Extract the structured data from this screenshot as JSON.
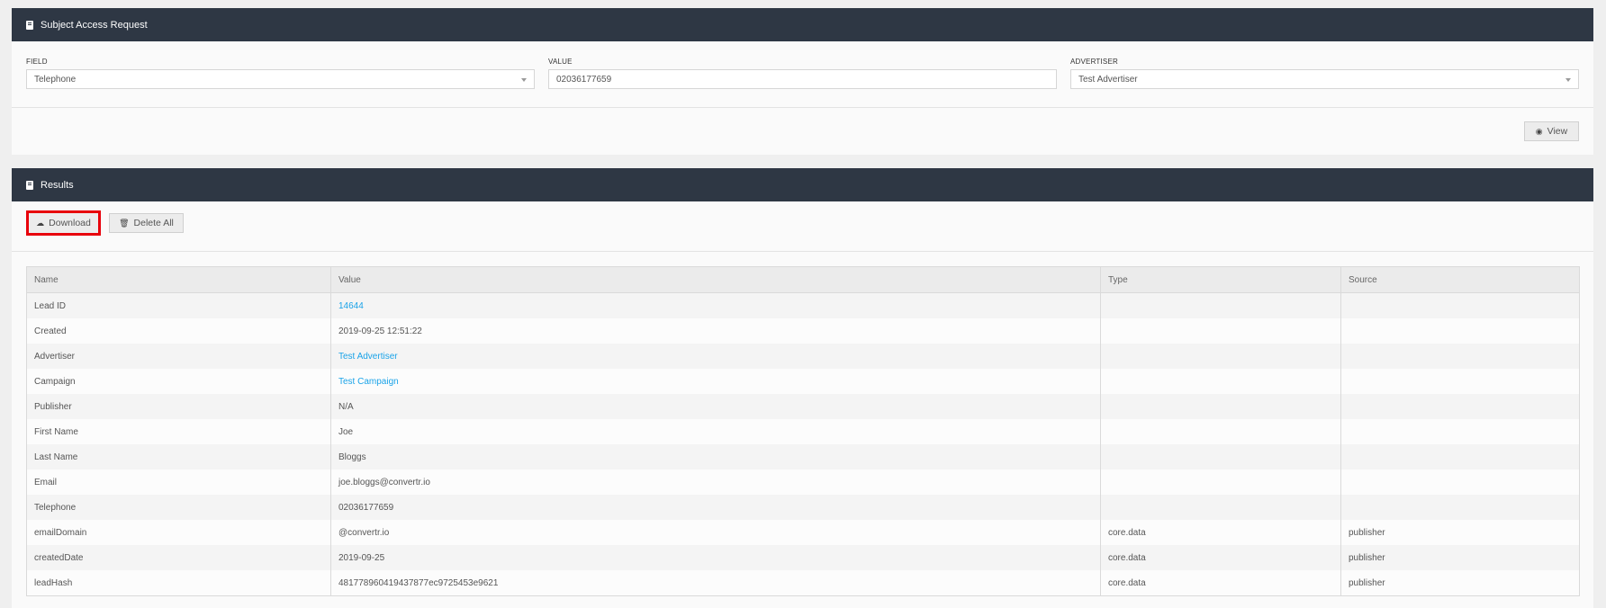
{
  "sar_panel": {
    "title": "Subject Access Request",
    "field": {
      "label": "FIELD",
      "value": "Telephone"
    },
    "value": {
      "label": "VALUE",
      "value": "02036177659"
    },
    "advertiser": {
      "label": "ADVERTISER",
      "value": "Test Advertiser"
    },
    "view_button": "View"
  },
  "results_panel": {
    "title": "Results",
    "download_button": "Download",
    "delete_all_button": "Delete All",
    "columns": [
      "Name",
      "Value",
      "Type",
      "Source"
    ],
    "rows": [
      {
        "name": "Lead ID",
        "value": "14644",
        "type": "",
        "source": ""
      },
      {
        "name": "Created",
        "value": "2019-09-25 12:51:22",
        "type": "",
        "source": ""
      },
      {
        "name": "Advertiser",
        "value": "Test Advertiser",
        "type": "",
        "source": ""
      },
      {
        "name": "Campaign",
        "value": "Test Campaign",
        "type": "",
        "source": ""
      },
      {
        "name": "Publisher",
        "value": "N/A",
        "type": "",
        "source": ""
      },
      {
        "name": "First Name",
        "value": "Joe",
        "type": "",
        "source": ""
      },
      {
        "name": "Last Name",
        "value": "Bloggs",
        "type": "",
        "source": ""
      },
      {
        "name": "Email",
        "value": "joe.bloggs@convertr.io",
        "type": "",
        "source": ""
      },
      {
        "name": "Telephone",
        "value": "02036177659",
        "type": "",
        "source": ""
      },
      {
        "name": "emailDomain",
        "value": "@convertr.io",
        "type": "core.data",
        "source": "publisher"
      },
      {
        "name": "createdDate",
        "value": "2019-09-25",
        "type": "core.data",
        "source": "publisher"
      },
      {
        "name": "leadHash",
        "value": "481778960419437877ec9725453e9621",
        "type": "core.data",
        "source": "publisher"
      }
    ]
  },
  "colors": {
    "header": "#2e3744",
    "link": "#1aa3e8",
    "highlight": "#e8000b"
  }
}
